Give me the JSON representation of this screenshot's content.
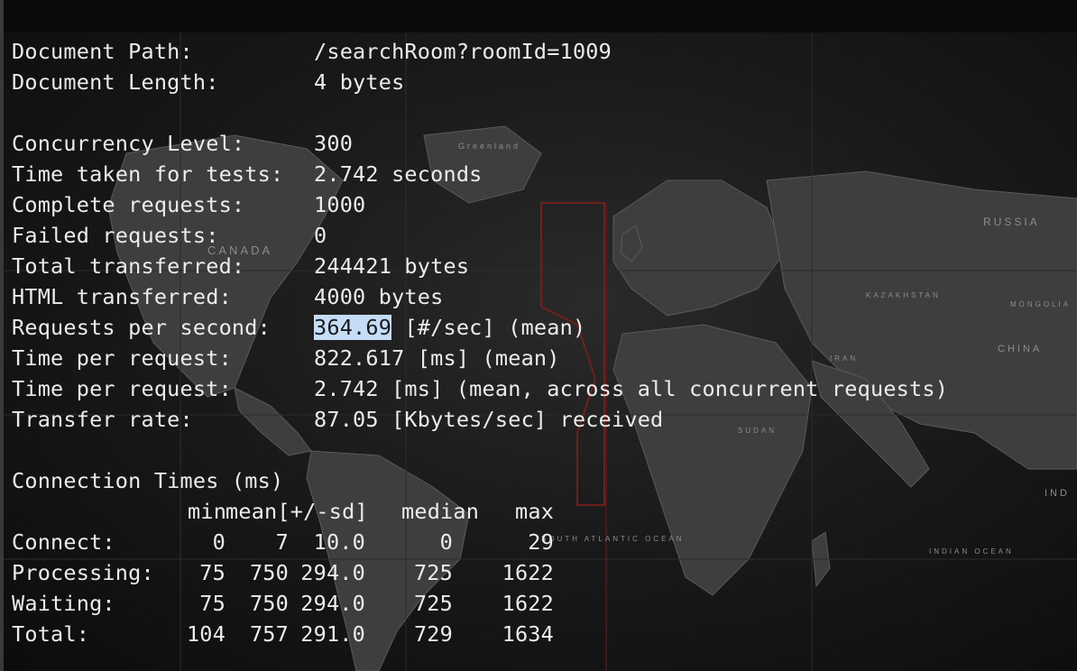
{
  "terminal": {
    "background": "#1a1a1a",
    "text_color": "#ececec",
    "selection_color": "#c5ddf7"
  },
  "map": {
    "labels": {
      "canada": "CANADA",
      "russia": "RUSSIA",
      "china": "CHINA",
      "india": "IND",
      "mongolia": "MONGOLIA",
      "kazakhstan": "KAZAKHSTAN",
      "iran": "IRAN",
      "sudan": "SUDAN",
      "greenland": "Greenland",
      "south_atlantic": "SOUTH ATLANTIC OCEAN",
      "indian_ocean": "INDIAN OCEAN"
    }
  },
  "doc": {
    "path_label": "Document Path:",
    "path_value": "/searchRoom?roomId=1009",
    "length_label": "Document Length:",
    "length_value": "4 bytes"
  },
  "stats": [
    {
      "label": "Concurrency Level:",
      "value": "300"
    },
    {
      "label": "Time taken for tests:",
      "value": "2.742 seconds"
    },
    {
      "label": "Complete requests:",
      "value": "1000"
    },
    {
      "label": "Failed requests:",
      "value": "0"
    },
    {
      "label": "Total transferred:",
      "value": "244421 bytes"
    },
    {
      "label": "HTML transferred:",
      "value": "4000 bytes"
    }
  ],
  "rps": {
    "label": "Requests per second:",
    "value_selected": "364.69",
    "value_rest": " [#/sec] (mean)"
  },
  "stats2": [
    {
      "label": "Time per request:",
      "value": "822.617 [ms] (mean)"
    },
    {
      "label": "Time per request:",
      "value": "2.742 [ms] (mean, across all concurrent requests)"
    },
    {
      "label": "Transfer rate:",
      "value": "87.05 [Kbytes/sec] received"
    }
  ],
  "connection_times": {
    "title": "Connection Times (ms)",
    "headers": {
      "min": "min",
      "meansd": "mean[+/-sd]",
      "median": "median",
      "max": "max"
    },
    "rows": [
      {
        "label": "Connect:",
        "min": "0",
        "mean": "7",
        "sd": "10.0",
        "median": "0",
        "max": "29"
      },
      {
        "label": "Processing:",
        "min": "75",
        "mean": "750",
        "sd": "294.0",
        "median": "725",
        "max": "1622"
      },
      {
        "label": "Waiting:",
        "min": "75",
        "mean": "750",
        "sd": "294.0",
        "median": "725",
        "max": "1622"
      },
      {
        "label": "Total:",
        "min": "104",
        "mean": "757",
        "sd": "291.0",
        "median": "729",
        "max": "1634"
      }
    ]
  }
}
